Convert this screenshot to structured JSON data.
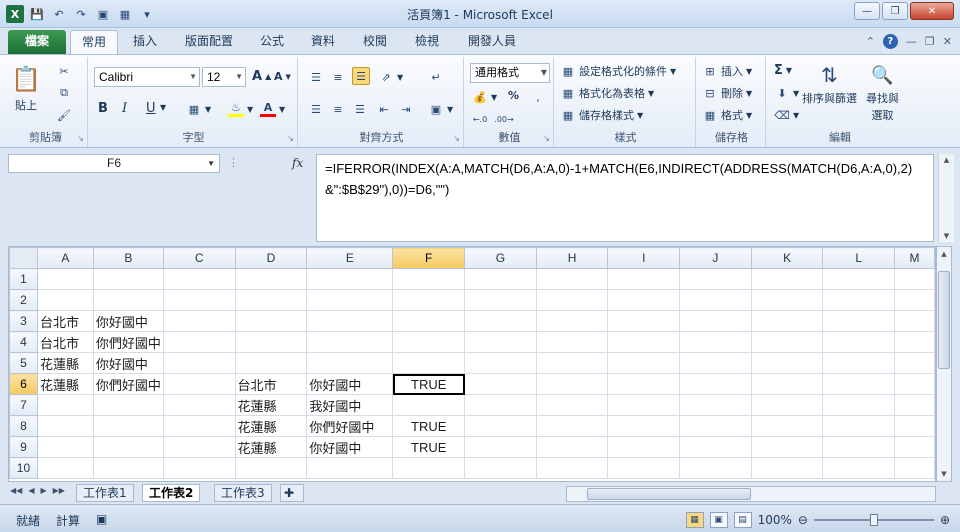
{
  "window": {
    "title": "活頁簿1 - Microsoft Excel",
    "app_logo": "X"
  },
  "tabs": {
    "file": "檔案",
    "items": [
      "常用",
      "插入",
      "版面配置",
      "公式",
      "資料",
      "校閱",
      "檢視",
      "開發人員"
    ]
  },
  "ribbon": {
    "clipboard": {
      "label": "剪貼簿",
      "paste": "貼上"
    },
    "font": {
      "label": "字型",
      "name": "Calibri",
      "size": "12",
      "bold": "B",
      "italic": "I",
      "underline": "U"
    },
    "alignment": {
      "label": "對齊方式"
    },
    "number": {
      "label": "數值",
      "format": "通用格式",
      "percent": "%"
    },
    "styles": {
      "label": "樣式",
      "conditional": "設定格式化的條件",
      "as_table": "格式化為表格",
      "cell_styles": "儲存格樣式"
    },
    "cells": {
      "label": "儲存格",
      "insert": "插入",
      "delete": "刪除",
      "format": "格式"
    },
    "editing": {
      "label": "編輯",
      "sum": "Σ",
      "sort_filter_1": "排序與篩選",
      "find_1": "尋找與",
      "find_2": "選取"
    }
  },
  "formula_bar": {
    "name_box": "F6",
    "fx": "fx",
    "formula": "=IFERROR(INDEX(A:A,MATCH(D6,A:A,0)-1+MATCH(E6,INDIRECT(ADDRESS(MATCH(D6,A:A,0),2)&\":$B$29\"),0))=D6,\"\")"
  },
  "grid": {
    "columns": [
      "A",
      "B",
      "C",
      "D",
      "E",
      "F",
      "G",
      "H",
      "I",
      "J",
      "K",
      "L",
      "M"
    ],
    "selected_column": "F",
    "selected_row": 6,
    "rows": [
      {
        "n": "1",
        "cells": [
          "",
          "",
          "",
          "",
          "",
          "",
          "",
          "",
          "",
          "",
          "",
          "",
          ""
        ]
      },
      {
        "n": "2",
        "cells": [
          "",
          "",
          "",
          "",
          "",
          "",
          "",
          "",
          "",
          "",
          "",
          "",
          ""
        ]
      },
      {
        "n": "3",
        "cells": [
          "台北市",
          "你好國中",
          "",
          "",
          "",
          "",
          "",
          "",
          "",
          "",
          "",
          "",
          ""
        ]
      },
      {
        "n": "4",
        "cells": [
          "台北市",
          "你們好國中",
          "",
          "",
          "",
          "",
          "",
          "",
          "",
          "",
          "",
          "",
          ""
        ]
      },
      {
        "n": "5",
        "cells": [
          "花蓮縣",
          "你好國中",
          "",
          "",
          "",
          "",
          "",
          "",
          "",
          "",
          "",
          "",
          ""
        ]
      },
      {
        "n": "6",
        "cells": [
          "花蓮縣",
          "你們好國中",
          "",
          "台北市",
          "你好國中",
          "TRUE",
          "",
          "",
          "",
          "",
          "",
          "",
          ""
        ]
      },
      {
        "n": "7",
        "cells": [
          "",
          "",
          "",
          "花蓮縣",
          "我好國中",
          "",
          "",
          "",
          "",
          "",
          "",
          "",
          ""
        ]
      },
      {
        "n": "8",
        "cells": [
          "",
          "",
          "",
          "花蓮縣",
          "你們好國中",
          "TRUE",
          "",
          "",
          "",
          "",
          "",
          "",
          ""
        ]
      },
      {
        "n": "9",
        "cells": [
          "",
          "",
          "",
          "花蓮縣",
          "你好國中",
          "TRUE",
          "",
          "",
          "",
          "",
          "",
          "",
          ""
        ]
      },
      {
        "n": "10",
        "cells": [
          "",
          "",
          "",
          "",
          "",
          "",
          "",
          "",
          "",
          "",
          "",
          "",
          ""
        ]
      }
    ]
  },
  "sheets": {
    "tabs": [
      "工作表1",
      "工作表2",
      "工作表3"
    ],
    "active": "工作表2"
  },
  "status": {
    "ready": "就緒",
    "calculate": "計算",
    "zoom": "100%"
  }
}
